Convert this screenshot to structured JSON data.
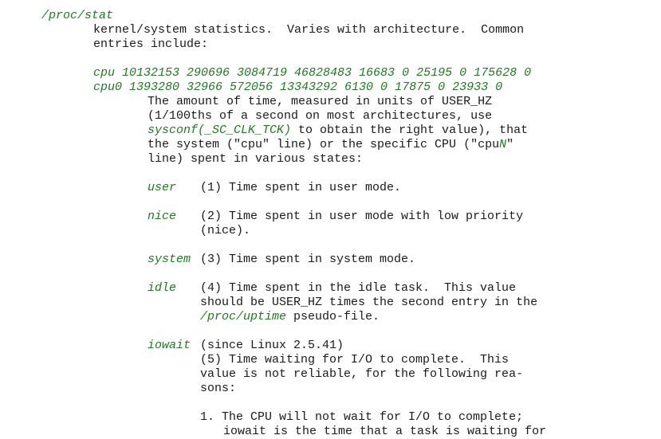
{
  "section": {
    "path": "/proc/stat",
    "description_lines": [
      "kernel/system statistics.  Varies with architecture.  Common",
      "entries include:"
    ],
    "cpu_line": "cpu 10132153 290696 3084719 46828483 16683 0 25195 0 175628 0",
    "cpu0_line": "cpu0 1393280 32966 572056 13343292 6130 0 17875 0 23933 0",
    "intro": {
      "line1": "The amount of time, measured in units of USER_HZ",
      "line2": "(1/100ths of a second on most architectures, use",
      "line3_code": "sysconf(_SC_CLK_TCK)",
      "line3_rest": " to obtain the right value), that",
      "line4_start": "the system (\"cpu\" line) or the specific CPU (\"cpu",
      "line4_var": "N",
      "line4_end": "\"",
      "line5": "line) spent in various states:"
    },
    "fields": {
      "user": {
        "name": "user",
        "line1": "(1) Time spent in user mode."
      },
      "nice": {
        "name": "nice",
        "line1": "(2) Time spent in user mode with low priority",
        "line2": "(nice)."
      },
      "system": {
        "name": "system",
        "line1": "(3) Time spent in system mode."
      },
      "idle": {
        "name": "idle",
        "line1": "(4) Time spent in the idle task.  This value",
        "line2": "should be USER_HZ times the second entry in the",
        "line3_link": "/proc/uptime",
        "line3_rest": " pseudo-file."
      },
      "iowait": {
        "name": "iowait",
        "line1": "(since Linux 2.5.41)",
        "line2": "(5) Time waiting for I/O to complete.  This",
        "line3": "value is not reliable, for the following rea-",
        "line4": "sons:",
        "reason1_line1": "1. The CPU will not wait for I/O to complete;",
        "reason1_line2": "iowait is the time that a task is waiting for"
      }
    }
  }
}
